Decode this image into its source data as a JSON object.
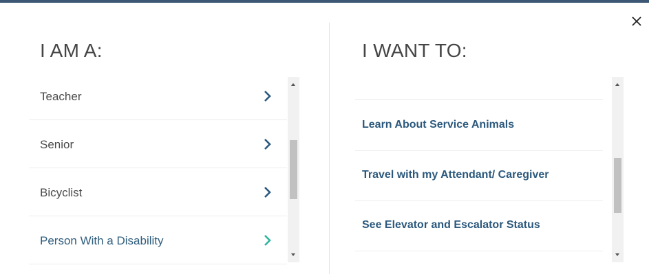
{
  "modal": {
    "close_icon": "close-icon",
    "accent_color": "#3d5875"
  },
  "left_panel": {
    "heading": "I AM A:",
    "items": [
      {
        "label": "Teacher",
        "icon": "chevron-right-icon",
        "active": false
      },
      {
        "label": "Senior",
        "icon": "chevron-right-icon",
        "active": false
      },
      {
        "label": "Bicyclist",
        "icon": "chevron-right-icon",
        "active": false
      },
      {
        "label": "Person With a Disability",
        "icon": "chevron-right-icon",
        "active": true
      }
    ],
    "active_color": "#2fb5a0"
  },
  "right_panel": {
    "heading": "I WANT TO:",
    "items": [
      {
        "label": "Learn About Service Animals"
      },
      {
        "label": "Travel with my Attendant/ Caregiver"
      },
      {
        "label": "See Elevator and Escalator Status"
      }
    ],
    "link_color": "#2b587c"
  }
}
